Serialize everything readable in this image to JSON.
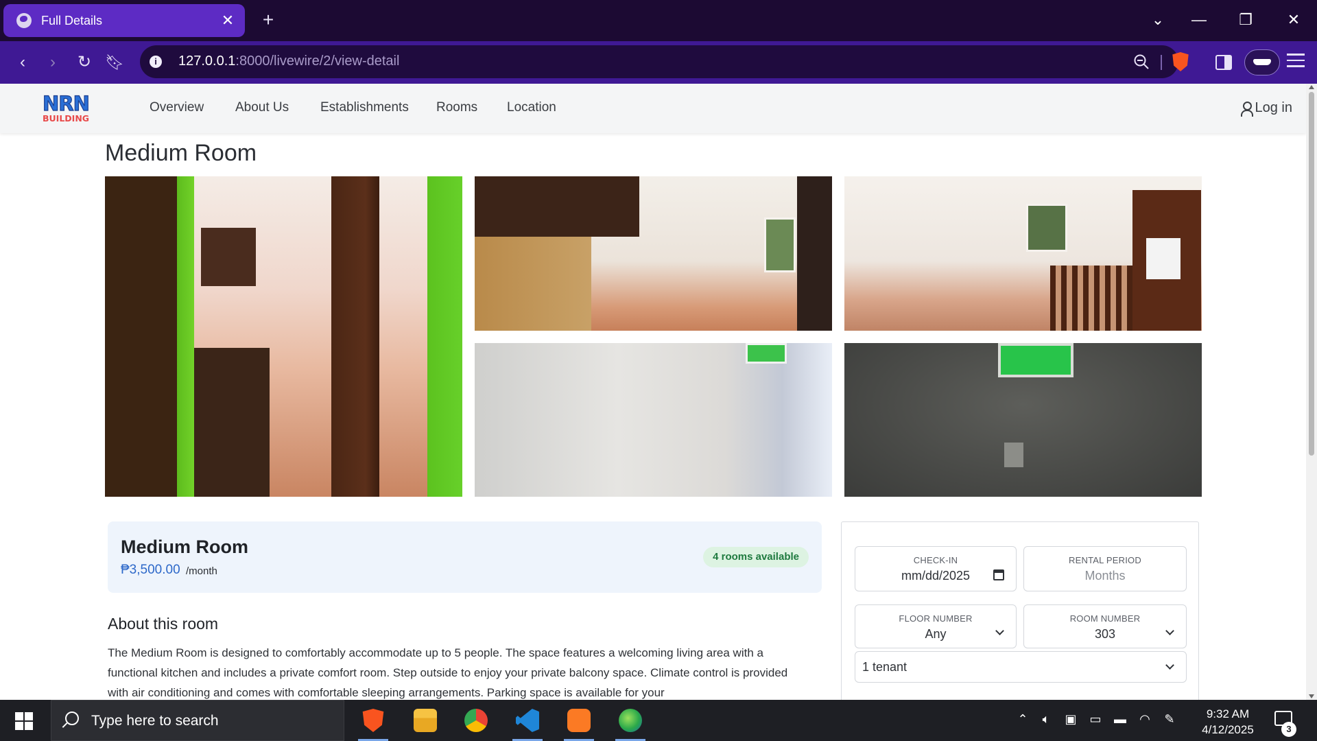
{
  "browser": {
    "tab_title": "Full Details",
    "url_host": "127.0.0.1",
    "url_path": ":8000/livewire/2/view-detail",
    "accent": "#5d2bc4",
    "toolbar_color": "#3f1994"
  },
  "site": {
    "logo": {
      "line1": "NRN",
      "line2": "BUILDING"
    },
    "nav": [
      "Overview",
      "About Us",
      "Establishments",
      "Rooms",
      "Location"
    ],
    "login_label": "Log in"
  },
  "room": {
    "page_title": "Medium Room",
    "name": "Medium Room",
    "price": "₱3,500.00",
    "price_unit": "/month",
    "availability": "4 rooms available",
    "about_heading": "About this room",
    "about_text": "The Medium Room is designed to comfortably accommodate up to 5 people. The space features a welcoming living area with a functional kitchen and includes a private comfort room. Step outside to enjoy your private balcony space. Climate control is provided with air conditioning and comes with comfortable sleeping arrangements. Parking space is available for your"
  },
  "booking": {
    "checkin_label": "CHECK-IN",
    "checkin_value": "mm/dd/2025",
    "period_label": "RENTAL PERIOD",
    "period_placeholder": "Months",
    "floor_label": "FLOOR NUMBER",
    "floor_value": "Any",
    "room_label": "ROOM NUMBER",
    "room_value": "303",
    "tenant_value": "1 tenant"
  },
  "taskbar": {
    "search_placeholder": "Type here to search",
    "time": "9:32 AM",
    "date": "4/12/2025",
    "notification_count": "3",
    "apps": [
      "brave-browser",
      "file-explorer",
      "chrome",
      "vscode",
      "xampp",
      "eclipse-like-app"
    ]
  }
}
